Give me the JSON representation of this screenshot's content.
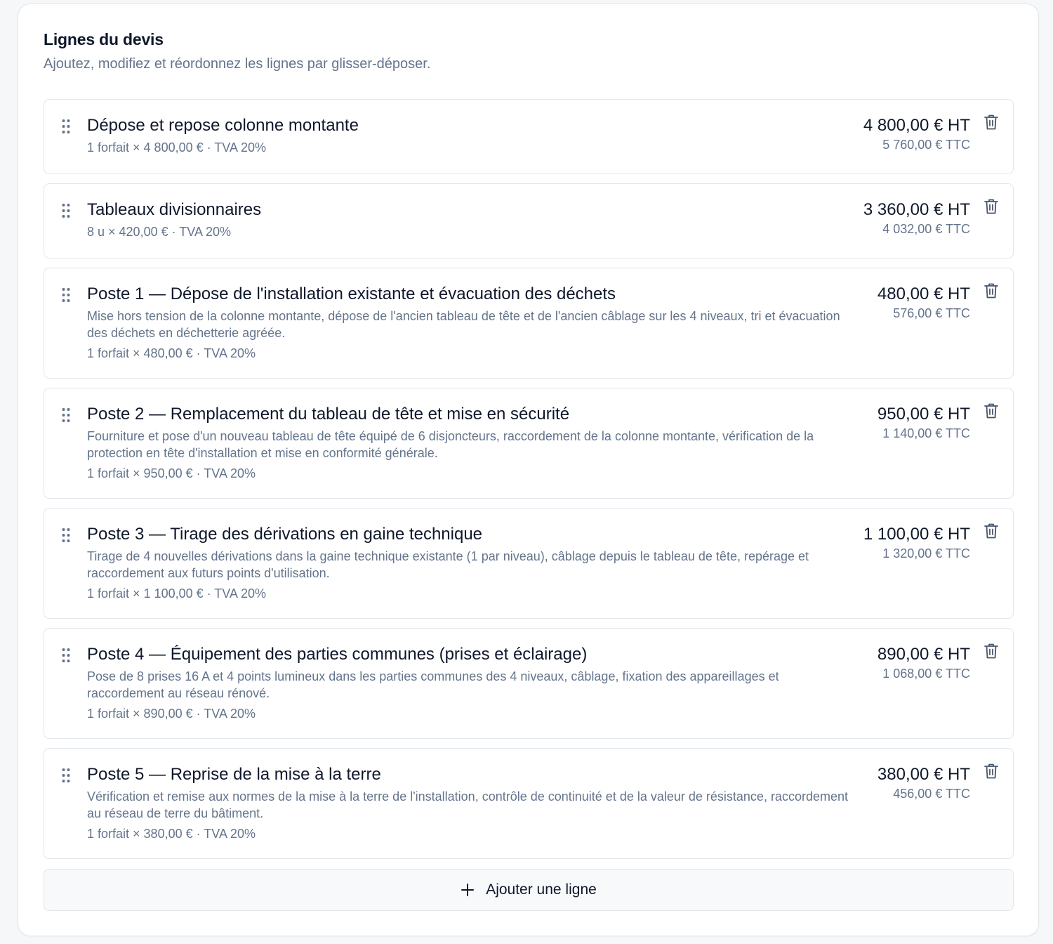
{
  "header": {
    "title": "Lignes du devis",
    "subtitle": "Ajoutez, modifiez et réordonnez les lignes par glisser-déposer."
  },
  "lines": [
    {
      "title": "Dépose et repose colonne montante",
      "description": "",
      "meta": "1 forfait × 4 800,00 € · TVA 20%",
      "amount_ht": "4 800,00 € HT",
      "amount_ttc": "5 760,00 € TTC"
    },
    {
      "title": "Tableaux divisionnaires",
      "description": "",
      "meta": "8 u × 420,00 € · TVA 20%",
      "amount_ht": "3 360,00 € HT",
      "amount_ttc": "4 032,00 € TTC"
    },
    {
      "title": "Poste 1 — Dépose de l'installation existante et évacuation des déchets",
      "description": "Mise hors tension de la colonne montante, dépose de l'ancien tableau de tête et de l'ancien câblage sur les 4 niveaux, tri et évacuation des déchets en déchetterie agréée.",
      "meta": "1 forfait × 480,00 € · TVA 20%",
      "amount_ht": "480,00 € HT",
      "amount_ttc": "576,00 € TTC"
    },
    {
      "title": "Poste 2 — Remplacement du tableau de tête et mise en sécurité",
      "description": "Fourniture et pose d'un nouveau tableau de tête équipé de 6 disjoncteurs, raccordement de la colonne montante, vérification de la protection en tête d'installation et mise en conformité générale.",
      "meta": "1 forfait × 950,00 € · TVA 20%",
      "amount_ht": "950,00 € HT",
      "amount_ttc": "1 140,00 € TTC"
    },
    {
      "title": "Poste 3 — Tirage des dérivations en gaine technique",
      "description": "Tirage de 4 nouvelles dérivations dans la gaine technique existante (1 par niveau), câblage depuis le tableau de tête, repérage et raccordement aux futurs points d'utilisation.",
      "meta": "1 forfait × 1 100,00 € · TVA 20%",
      "amount_ht": "1 100,00 € HT",
      "amount_ttc": "1 320,00 € TTC"
    },
    {
      "title": "Poste 4 — Équipement des parties communes (prises et éclairage)",
      "description": "Pose de 8 prises 16 A et 4 points lumineux dans les parties communes des 4 niveaux, câblage, fixation des appareillages et raccordement au réseau rénové.",
      "meta": "1 forfait × 890,00 € · TVA 20%",
      "amount_ht": "890,00 € HT",
      "amount_ttc": "1 068,00 € TTC"
    },
    {
      "title": "Poste 5 — Reprise de la mise à la terre",
      "description": "Vérification et remise aux normes de la mise à la terre de l'installation, contrôle de continuité et de la valeur de résistance, raccordement au réseau de terre du bâtiment.",
      "meta": "1 forfait × 380,00 € · TVA 20%",
      "amount_ht": "380,00 € HT",
      "amount_ttc": "456,00 € TTC"
    }
  ],
  "icons": {
    "drag": "drag-handle-icon",
    "delete": "trash-icon",
    "add": "plus-icon"
  },
  "actions": {
    "add_line_label": "Ajouter une ligne"
  },
  "colors": {
    "text_primary": "#0f172a",
    "text_secondary": "#64748b",
    "border": "#e2e5ea",
    "background": "#f6f7f9",
    "icon": "#475569"
  }
}
